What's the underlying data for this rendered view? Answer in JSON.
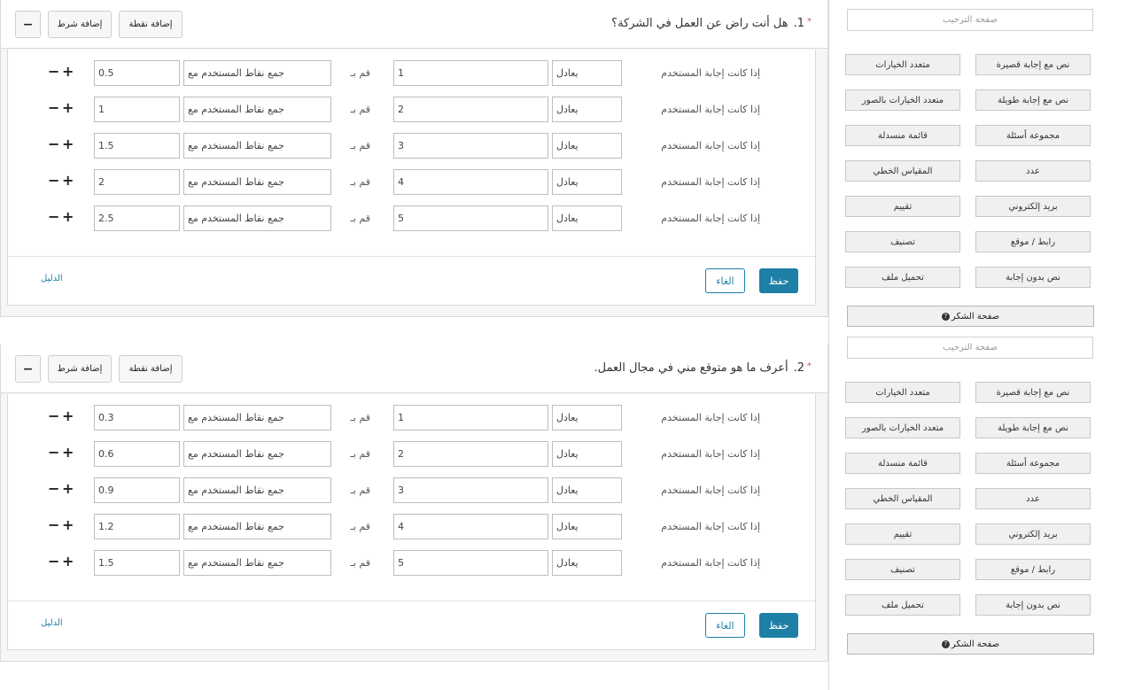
{
  "questions": [
    {
      "number": "1.",
      "required_mark": "*",
      "title": "هل أنت راض عن العمل في الشركة؟",
      "add_point_label": "إضافة نقطة",
      "add_condition_label": "إضافة شرط",
      "collapse_label": "−",
      "rules": [
        {
          "if_label": "إذا كانت إجابة المستخدم",
          "operator": "يعادل",
          "answer": "1",
          "then_label": "قم بـ",
          "action": "جمع نقاط المستخدم مع",
          "points": "0.5"
        },
        {
          "if_label": "إذا كانت إجابة المستخدم",
          "operator": "يعادل",
          "answer": "2",
          "then_label": "قم بـ",
          "action": "جمع نقاط المستخدم مع",
          "points": "1"
        },
        {
          "if_label": "إذا كانت إجابة المستخدم",
          "operator": "يعادل",
          "answer": "3",
          "then_label": "قم بـ",
          "action": "جمع نقاط المستخدم مع",
          "points": "1.5"
        },
        {
          "if_label": "إذا كانت إجابة المستخدم",
          "operator": "يعادل",
          "answer": "4",
          "then_label": "قم بـ",
          "action": "جمع نقاط المستخدم مع",
          "points": "2"
        },
        {
          "if_label": "إذا كانت إجابة المستخدم",
          "operator": "يعادل",
          "answer": "5",
          "then_label": "قم بـ",
          "action": "جمع نقاط المستخدم مع",
          "points": "2.5"
        }
      ],
      "save_label": "حفظ",
      "cancel_label": "الغاء",
      "guide_label": "الدليل"
    },
    {
      "number": "2.",
      "required_mark": "*",
      "title": "أعرف ما هو متوقع مني في مجال العمل.",
      "add_point_label": "إضافة نقطة",
      "add_condition_label": "إضافة شرط",
      "collapse_label": "−",
      "rules": [
        {
          "if_label": "إذا كانت إجابة المستخدم",
          "operator": "يعادل",
          "answer": "1",
          "then_label": "قم بـ",
          "action": "جمع نقاط المستخدم مع",
          "points": "0.3"
        },
        {
          "if_label": "إذا كانت إجابة المستخدم",
          "operator": "يعادل",
          "answer": "2",
          "then_label": "قم بـ",
          "action": "جمع نقاط المستخدم مع",
          "points": "0.6"
        },
        {
          "if_label": "إذا كانت إجابة المستخدم",
          "operator": "يعادل",
          "answer": "3",
          "then_label": "قم بـ",
          "action": "جمع نقاط المستخدم مع",
          "points": "0.9"
        },
        {
          "if_label": "إذا كانت إجابة المستخدم",
          "operator": "يعادل",
          "answer": "4",
          "then_label": "قم بـ",
          "action": "جمع نقاط المستخدم مع",
          "points": "1.2"
        },
        {
          "if_label": "إذا كانت إجابة المستخدم",
          "operator": "يعادل",
          "answer": "5",
          "then_label": "قم بـ",
          "action": "جمع نقاط المستخدم مع",
          "points": "1.5"
        }
      ],
      "save_label": "حفظ",
      "cancel_label": "الغاء",
      "guide_label": "الدليل"
    }
  ],
  "sidebar": {
    "groups": [
      {
        "welcome_label": "صفحة الترحيب",
        "items": [
          {
            "right": "نص مع إجابة قصيرة",
            "left": "متعدد الخيارات"
          },
          {
            "right": "نص مع إجابة طويلة",
            "left": "متعدد الخيارات بالصور"
          },
          {
            "right": "مجموعة أسئلة",
            "left": "قائمة منسدلة"
          },
          {
            "right": "عدد",
            "left": "المقياس الخطي"
          },
          {
            "right": "بريد إلكتروني",
            "left": "تقييم"
          },
          {
            "right": "رابط / موقع",
            "left": "تصنيف"
          },
          {
            "right": "نص بدون إجابة",
            "left": "تحميل ملف"
          }
        ],
        "thanks_label": "صفحة الشكر",
        "thanks_icon": "question-circle-icon"
      },
      {
        "welcome_label": "صفحة الترحيب",
        "items": [
          {
            "right": "نص مع إجابة قصيرة",
            "left": "متعدد الخيارات"
          },
          {
            "right": "نص مع إجابة طويلة",
            "left": "متعدد الخيارات بالصور"
          },
          {
            "right": "مجموعة أسئلة",
            "left": "قائمة منسدلة"
          },
          {
            "right": "عدد",
            "left": "المقياس الخطي"
          },
          {
            "right": "بريد إلكتروني",
            "left": "تقييم"
          },
          {
            "right": "رابط / موقع",
            "left": "تصنيف"
          },
          {
            "right": "نص بدون إجابة",
            "left": "تحميل ملف"
          }
        ],
        "thanks_label": "صفحة الشكر",
        "thanks_icon": "question-circle-icon"
      }
    ]
  },
  "colors": {
    "primary": "#1e7fa6",
    "required": "#d9534f"
  }
}
